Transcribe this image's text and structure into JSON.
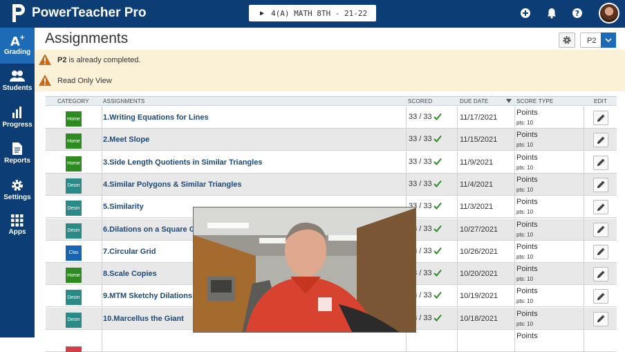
{
  "app": {
    "brand": "PowerTeacher Pro",
    "class_selector": "4(A) MATH 8TH - 21-22"
  },
  "icons": {
    "add": "add-circle-icon",
    "notifications": "bell-icon",
    "help": "help-icon",
    "settings": "gear-icon",
    "edit": "pencil-icon",
    "scored": "check-icon",
    "warning": "warning-icon"
  },
  "colors": {
    "topbar": "#0c3e75",
    "sidebar_active": "#1d6bb7",
    "home": "#2e8b22",
    "desm": "#2a8a87",
    "clas": "#1565b2",
    "check": "#2b8c27"
  },
  "sidebar": {
    "items": [
      {
        "label": "Grading"
      },
      {
        "label": "Students"
      },
      {
        "label": "Progress"
      },
      {
        "label": "Reports"
      },
      {
        "label": "Settings"
      },
      {
        "label": "Apps"
      }
    ]
  },
  "page": {
    "title": "Assignments",
    "term": "P2"
  },
  "alerts": {
    "completed_term": "P2",
    "completed_rest": " is already completed.",
    "read_only": "Read Only View"
  },
  "table": {
    "headers": {
      "category": "CATEGORY",
      "assignments": "ASSIGNMENTS",
      "scored": "SCORED",
      "due_date": "DUE DATE",
      "score_type": "SCORE TYPE",
      "edit": "EDIT"
    },
    "rows": [
      {
        "category": "Home",
        "name": "1.Writing Equations for Lines",
        "scored": "33 / 33",
        "due": "11/17/2021",
        "score_type": "Points",
        "pts": "pts: 10"
      },
      {
        "category": "Home",
        "name": "2.Meet Slope",
        "scored": "33 / 33",
        "due": "11/15/2021",
        "score_type": "Points",
        "pts": "pts: 10"
      },
      {
        "category": "Home",
        "name": "3.Side Length Quotients in Similar Triangles",
        "scored": "33 / 33",
        "due": "11/9/2021",
        "score_type": "Points",
        "pts": "pts: 10"
      },
      {
        "category": "Desm",
        "name": "4.Similar Polygons & Similar Triangles",
        "scored": "33 / 33",
        "due": "11/4/2021",
        "score_type": "Points",
        "pts": "pts: 10"
      },
      {
        "category": "Desm",
        "name": "5.Similarity",
        "scored": "33 / 33",
        "due": "11/3/2021",
        "score_type": "Points",
        "pts": "pts: 10"
      },
      {
        "category": "Desm",
        "name": "6.Dilations on a Square Gr",
        "scored": "33 / 33",
        "due": "10/27/2021",
        "score_type": "Points",
        "pts": "pts: 10"
      },
      {
        "category": "Clas",
        "name": "7.Circular Grid",
        "scored": "33 / 33",
        "due": "10/26/2021",
        "score_type": "Points",
        "pts": "pts: 10"
      },
      {
        "category": "Home",
        "name": "8.Scale Copies",
        "scored": "33 / 33",
        "due": "10/20/2021",
        "score_type": "Points",
        "pts": "pts: 10"
      },
      {
        "category": "Desm",
        "name": "9.MTM Sketchy Dilations",
        "scored": "33 / 33",
        "due": "10/19/2021",
        "score_type": "Points",
        "pts": "pts: 10"
      },
      {
        "category": "Desm",
        "name": "10.Marcellus the Giant",
        "scored": "33 / 33",
        "due": "10/18/2021",
        "score_type": "Points",
        "pts": "pts: 10"
      },
      {
        "category": "",
        "name": "",
        "scored": "",
        "due": "",
        "score_type": "Points",
        "pts": ""
      }
    ]
  }
}
